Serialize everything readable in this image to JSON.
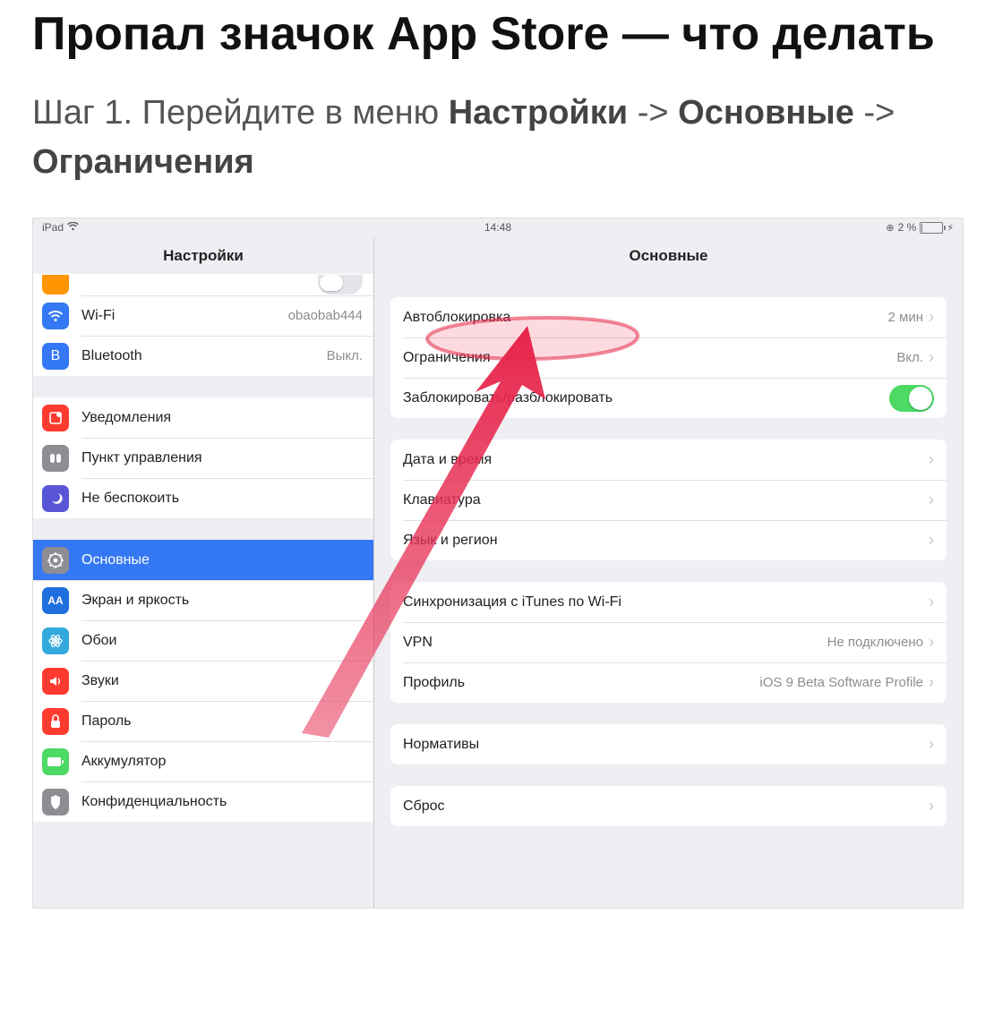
{
  "article": {
    "title": "Пропал значок App Store — что делать",
    "step_prefix": "Шаг 1. Перейдите в меню ",
    "step_b1": "Настройки",
    "step_arrow": " -> ",
    "step_b2": "Основные",
    "step_arrow2": " -> ",
    "step_b3": "Ограничения"
  },
  "status": {
    "device": "iPad",
    "time": "14:48",
    "battery_text": "2 %"
  },
  "sidebar": {
    "title": "Настройки",
    "items": {
      "wifi": {
        "label": "Wi-Fi",
        "value": "obaobab444"
      },
      "bluetooth": {
        "label": "Bluetooth",
        "value": "Выкл."
      },
      "notifications": {
        "label": "Уведомления"
      },
      "control_center": {
        "label": "Пункт управления"
      },
      "dnd": {
        "label": "Не беспокоить"
      },
      "general": {
        "label": "Основные"
      },
      "display": {
        "label": "Экран и яркость"
      },
      "wallpaper": {
        "label": "Обои"
      },
      "sounds": {
        "label": "Звуки"
      },
      "passcode": {
        "label": "Пароль"
      },
      "battery": {
        "label": "Аккумулятор"
      },
      "privacy": {
        "label": "Конфиденциальность"
      }
    }
  },
  "panel": {
    "title": "Основные",
    "g1": {
      "autolock": {
        "label": "Автоблокировка",
        "value": "2 мин"
      },
      "restrictions": {
        "label": "Ограничения",
        "value": "Вкл."
      },
      "lockunlock": {
        "label": "Заблокировать/разблокировать"
      }
    },
    "g2": {
      "datetime": {
        "label": "Дата и время"
      },
      "keyboard": {
        "label": "Клавиатура"
      },
      "language": {
        "label": "Язык и регион"
      }
    },
    "g3": {
      "itunes_wifi": {
        "label": "Синхронизация с iTunes по Wi-Fi"
      },
      "vpn": {
        "label": "VPN",
        "value": "Не подключено"
      },
      "profile": {
        "label": "Профиль",
        "value": "iOS 9 Beta Software Profile"
      }
    },
    "g4": {
      "regulatory": {
        "label": "Нормативы"
      }
    },
    "g5": {
      "reset": {
        "label": "Сброс"
      }
    }
  }
}
